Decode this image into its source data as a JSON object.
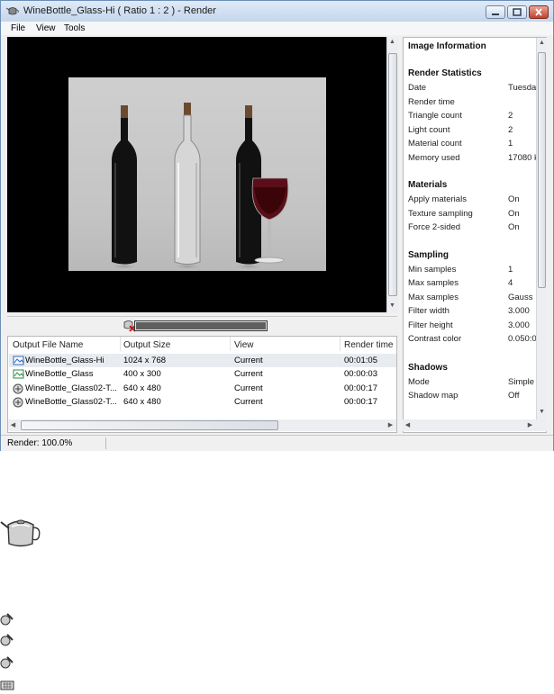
{
  "window": {
    "title": "WineBottle_Glass-Hi  ( Ratio 1 : 2 ) - Render"
  },
  "menu": [
    "File",
    "View",
    "Tools"
  ],
  "progress": {
    "fraction": 1.0
  },
  "list": {
    "columns": [
      "Output File Name",
      "Output Size",
      "View",
      "Render time"
    ],
    "rows": [
      {
        "name": "WineBottle_Glass-Hi",
        "size": "1024 x 768",
        "view": "Current",
        "time": "00:01:05",
        "icon": "image-file-icon"
      },
      {
        "name": "WineBottle_Glass",
        "size": "400 x 300",
        "view": "Current",
        "time": "00:00:03",
        "icon": "image-file-icon"
      },
      {
        "name": "WineBottle_Glass02-T...",
        "size": "640 x 480",
        "view": "Current",
        "time": "00:00:17",
        "icon": "render-file-icon"
      },
      {
        "name": "WineBottle_Glass02-T...",
        "size": "640 x 480",
        "view": "Current",
        "time": "00:00:17",
        "icon": "render-file-icon"
      }
    ]
  },
  "info": {
    "title": "Image Information",
    "sections": [
      {
        "heading": "Render Statistics",
        "items": [
          {
            "label": "Date",
            "value": "Tuesda"
          },
          {
            "label": "Render time",
            "value": ""
          },
          {
            "label": "Triangle count",
            "value": "2"
          },
          {
            "label": "Light count",
            "value": "2"
          },
          {
            "label": "Material count",
            "value": "1"
          },
          {
            "label": "Memory used",
            "value": "17080 k"
          }
        ]
      },
      {
        "heading": "Materials",
        "items": [
          {
            "label": "Apply materials",
            "value": "On"
          },
          {
            "label": "Texture sampling",
            "value": "On"
          },
          {
            "label": "Force 2-sided",
            "value": "On"
          }
        ]
      },
      {
        "heading": "Sampling",
        "items": [
          {
            "label": "Min samples",
            "value": "1"
          },
          {
            "label": "Max samples",
            "value": "4"
          },
          {
            "label": "Max samples",
            "value": "Gauss"
          },
          {
            "label": "Filter width",
            "value": "3.000"
          },
          {
            "label": "Filter height",
            "value": "3.000"
          },
          {
            "label": "Contrast color",
            "value": "0.050:0"
          }
        ]
      },
      {
        "heading": "Shadows",
        "items": [
          {
            "label": "Mode",
            "value": "Simple"
          },
          {
            "label": "Shadow map",
            "value": "Off"
          }
        ]
      }
    ]
  },
  "status": {
    "text": "Render: 100.0%"
  },
  "desktop_icons": [
    "teapot-icon",
    "render-file-icon",
    "render-file-icon",
    "render-file-icon",
    "keyboard-icon"
  ]
}
